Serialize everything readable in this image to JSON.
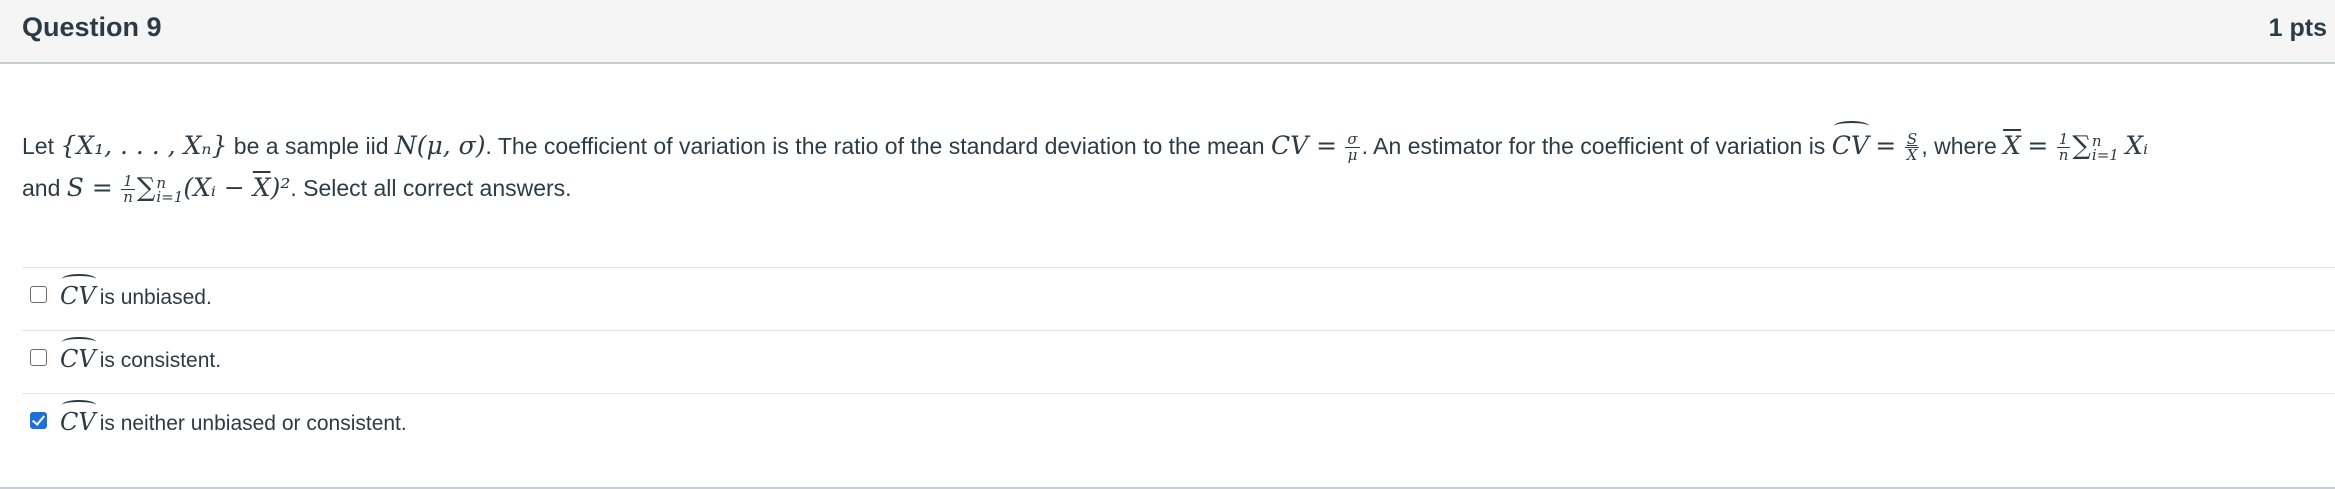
{
  "question": {
    "title": "Question 9",
    "points": "1 pts"
  },
  "prompt": {
    "t_let": "Let ",
    "m_set": "{X₁, . . . , Xₙ}",
    "t_sample": " be a sample iid ",
    "m_normal": "N(μ, σ)",
    "t_cv_def": ". The coefficient of variation is the ratio of the standard deviation to the mean ",
    "m_cv": "CV =",
    "m_sigma": "σ",
    "m_mu": "μ",
    "t_estimator": ". An estimator for the coefficient of variation is ",
    "m_cvhat": "CV",
    "m_eq": "=",
    "m_s": "S",
    "m_xbar": "X",
    "t_where": ", where ",
    "m_xbar_def": "X",
    "m_eq2": "=",
    "m_one": "1",
    "m_n": "n",
    "m_sum": "∑",
    "m_sum_top": "n",
    "m_sum_bot": "i=1",
    "m_xi": "Xᵢ",
    "t_and": "and ",
    "m_s_def": "S =",
    "m_one2": "1",
    "m_n2": "n",
    "m_sum2": "∑",
    "m_sum2_top": "n",
    "m_sum2_bot": "i=1",
    "m_term_open": "(Xᵢ − ",
    "m_term_xbar": "X",
    "m_term_close": ")²",
    "t_select": ". Select all correct answers."
  },
  "answers": [
    {
      "math": "CV",
      "text": "is unbiased.",
      "checked": false
    },
    {
      "math": "CV",
      "text": "is consistent.",
      "checked": false
    },
    {
      "math": "CV",
      "text": "is neither unbiased or consistent.",
      "checked": true
    }
  ],
  "colors": {
    "header_bg": "#f5f5f5",
    "text": "#2d3b45",
    "checkbox_checked": "#1f6fdb",
    "divider": "#e1e4e6"
  }
}
